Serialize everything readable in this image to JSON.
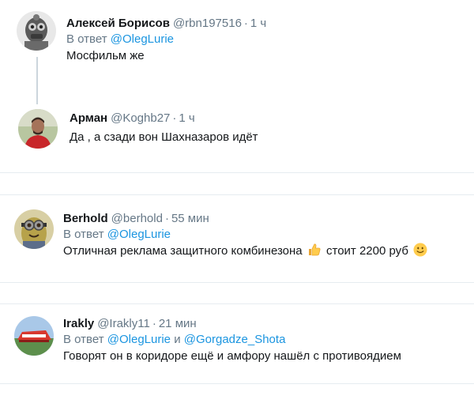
{
  "tweets": [
    {
      "name": "Алексей Борисов",
      "handle": "@rbn197516",
      "separator": "·",
      "time": "1 ч",
      "reply_prefix": "В ответ",
      "mentions": [
        "@OlegLurie"
      ],
      "text": "Мосфильм же",
      "avatar_icon": "helmet-robot-avatar"
    },
    {
      "name": "Арман",
      "handle": "@Koghb27",
      "separator": "·",
      "time": "1 ч",
      "text": "Да , а сзади вон Шахназаров идёт",
      "avatar_icon": "person-photo-avatar"
    },
    {
      "name": "Berhold",
      "handle": "@berhold",
      "separator": "·",
      "time": "55 мин",
      "reply_prefix": "В ответ",
      "mentions": [
        "@OlegLurie"
      ],
      "text_before_emoji": "Отличная реклама защитного комбинезона",
      "text_after_emoji": "стоит 2200 руб",
      "emojis": [
        "thumbs-up-icon",
        "smiling-face-icon"
      ],
      "avatar_icon": "minion-avatar"
    },
    {
      "name": "Irakly",
      "handle": "@Irakly11",
      "separator": "·",
      "time": "21 мин",
      "reply_prefix": "В ответ",
      "mentions": [
        "@OlegLurie",
        "@Gorgadze_Shota"
      ],
      "mention_joiner": "и",
      "text": "Говорят он в коридоре ещё и амфору нашёл с противоядием",
      "avatar_icon": "stadium-photo-avatar"
    }
  ],
  "colors": {
    "link": "#1b95e0",
    "secondary_text": "#657786",
    "primary_text": "#14171a",
    "divider": "#e6ecf0",
    "thread_line": "#ccd6dd"
  }
}
